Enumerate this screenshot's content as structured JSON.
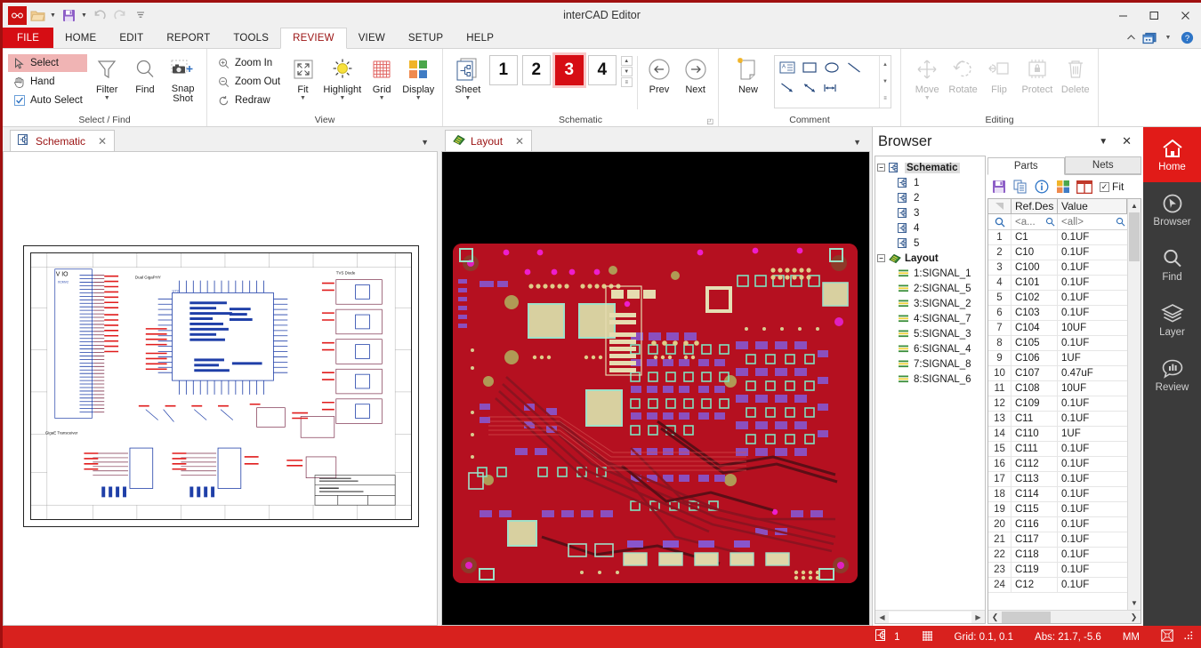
{
  "window": {
    "title": "interCAD Editor",
    "minimize": "–",
    "maximize": "☐",
    "close": "✕"
  },
  "quick_access": {
    "logo": "app-logo",
    "items": [
      {
        "name": "open-icon",
        "label": "Open",
        "has_arrow": true
      },
      {
        "name": "save-icon",
        "label": "Save",
        "has_arrow": true
      },
      {
        "name": "undo-icon",
        "label": "Undo",
        "has_arrow": false
      },
      {
        "name": "redo-icon",
        "label": "Redo",
        "has_arrow": false
      },
      {
        "name": "customize-icon",
        "label": "Customize Quick Access Toolbar",
        "has_arrow": false
      }
    ]
  },
  "menu": {
    "tabs": [
      {
        "label": "FILE",
        "type": "file"
      },
      {
        "label": "HOME",
        "type": "normal"
      },
      {
        "label": "EDIT",
        "type": "normal"
      },
      {
        "label": "REPORT",
        "type": "normal"
      },
      {
        "label": "TOOLS",
        "type": "normal"
      },
      {
        "label": "REVIEW",
        "type": "active"
      },
      {
        "label": "VIEW",
        "type": "normal"
      },
      {
        "label": "SETUP",
        "type": "normal"
      },
      {
        "label": "HELP",
        "type": "normal"
      }
    ],
    "right_icons": [
      "collapse-ribbon-icon",
      "window-mode-icon",
      "window-mode-caret",
      "help-icon"
    ]
  },
  "ribbon": {
    "groups": [
      {
        "label": "Select / Find",
        "small_commands": [
          {
            "label": "Select",
            "icon": "cursor-icon",
            "selected": true
          },
          {
            "label": "Hand",
            "icon": "hand-icon",
            "selected": false
          },
          {
            "label": "Auto Select",
            "icon": "checkbox-checked-icon",
            "selected": false
          }
        ],
        "big_commands": [
          {
            "label": "Filter",
            "icon": "funnel-icon",
            "caret": true,
            "disabled": false
          },
          {
            "label": "Find",
            "icon": "magnifier-icon",
            "caret": false,
            "disabled": false
          },
          {
            "label": "Snap Shot",
            "icon": "camera-plus-icon",
            "caret": false,
            "disabled": false
          }
        ]
      },
      {
        "label": "View",
        "small_commands": [
          {
            "label": "Zoom In",
            "icon": "zoom-in-icon",
            "selected": false
          },
          {
            "label": "Zoom Out",
            "icon": "zoom-out-icon",
            "selected": false
          },
          {
            "label": "Redraw",
            "icon": "refresh-icon",
            "selected": false
          }
        ],
        "big_commands": [
          {
            "label": "Fit",
            "icon": "fit-icon",
            "caret": true,
            "disabled": false
          },
          {
            "label": "Highlight",
            "icon": "sun-icon",
            "caret": true,
            "disabled": false
          },
          {
            "label": "Grid",
            "icon": "grid-icon",
            "caret": true,
            "disabled": false
          },
          {
            "label": "Display",
            "icon": "display-squares-icon",
            "caret": true,
            "disabled": false
          }
        ]
      },
      {
        "label": "Schematic",
        "has_dialog_launcher": true,
        "sheet_button": {
          "label": "Sheet",
          "icon": "sheet-icon",
          "caret": true
        },
        "sheets": [
          "1",
          "2",
          "3",
          "4"
        ],
        "active_sheet": "3",
        "nav": [
          {
            "label": "Prev",
            "icon": "arrow-left-circle-icon"
          },
          {
            "label": "Next",
            "icon": "arrow-right-circle-icon"
          }
        ]
      },
      {
        "label": "Comment",
        "new_button": {
          "label": "New",
          "icon": "new-note-icon"
        },
        "tools": [
          "text-box-icon",
          "rectangle-icon",
          "ellipse-icon",
          "line-icon",
          "arrow-icon",
          "double-arrow-icon",
          "dimension-icon"
        ]
      },
      {
        "label": "Editing",
        "big_commands": [
          {
            "label": "Move",
            "icon": "move-icon",
            "caret": true,
            "disabled": true
          },
          {
            "label": "Rotate",
            "icon": "rotate-icon",
            "caret": false,
            "disabled": true
          },
          {
            "label": "Flip",
            "icon": "flip-icon",
            "caret": false,
            "disabled": true
          },
          {
            "label": "Protect",
            "icon": "protect-chip-icon",
            "caret": false,
            "disabled": true
          },
          {
            "label": "Delete",
            "icon": "trash-icon",
            "caret": false,
            "disabled": true
          }
        ]
      }
    ]
  },
  "panes": [
    {
      "tab_label": "Schematic",
      "tab_icon": "schematic-icon",
      "close": "✕",
      "caret": "▼"
    },
    {
      "tab_label": "Layout",
      "tab_icon": "layout-board-icon",
      "close": "✕",
      "caret": "▼"
    }
  ],
  "browser": {
    "title": "Browser",
    "menu_icon": "▼",
    "close_icon": "✕",
    "tree": [
      {
        "label": "Schematic",
        "level": 0,
        "icon": "schematic-icon",
        "expanded": true,
        "selected": true
      },
      {
        "label": "1",
        "level": 1,
        "icon": "schematic-sheet-icon"
      },
      {
        "label": "2",
        "level": 1,
        "icon": "schematic-sheet-icon"
      },
      {
        "label": "3",
        "level": 1,
        "icon": "schematic-sheet-icon"
      },
      {
        "label": "4",
        "level": 1,
        "icon": "schematic-sheet-icon"
      },
      {
        "label": "5",
        "level": 1,
        "icon": "schematic-sheet-icon"
      },
      {
        "label": "Layout",
        "level": 0,
        "icon": "layout-board-icon",
        "expanded": true,
        "selected": false
      },
      {
        "label": "1:SIGNAL_1",
        "level": 1,
        "icon": "layer-stack-icon"
      },
      {
        "label": "2:SIGNAL_5",
        "level": 1,
        "icon": "layer-stack-icon"
      },
      {
        "label": "3:SIGNAL_2",
        "level": 1,
        "icon": "layer-stack-icon"
      },
      {
        "label": "4:SIGNAL_7",
        "level": 1,
        "icon": "layer-stack-icon"
      },
      {
        "label": "5:SIGNAL_3",
        "level": 1,
        "icon": "layer-stack-icon"
      },
      {
        "label": "6:SIGNAL_4",
        "level": 1,
        "icon": "layer-stack-icon"
      },
      {
        "label": "7:SIGNAL_8",
        "level": 1,
        "icon": "layer-stack-icon"
      },
      {
        "label": "8:SIGNAL_6",
        "level": 1,
        "icon": "layer-stack-icon"
      }
    ],
    "tabs": [
      {
        "label": "Parts",
        "active": true
      },
      {
        "label": "Nets",
        "active": false
      }
    ],
    "toolbar": {
      "icons": [
        "save-icon",
        "copy-icon",
        "info-icon",
        "colors-icon",
        "columns-icon"
      ],
      "fit_label": "Fit",
      "fit_checked": true,
      "fit_check_glyph": "✓"
    },
    "table": {
      "headers": [
        "",
        "Ref.Des",
        "Value"
      ],
      "filters": [
        "",
        "<a...",
        "<all>"
      ],
      "rows": [
        {
          "n": "1",
          "ref": "C1",
          "value": "0.1UF"
        },
        {
          "n": "2",
          "ref": "C10",
          "value": "0.1UF"
        },
        {
          "n": "3",
          "ref": "C100",
          "value": "0.1UF"
        },
        {
          "n": "4",
          "ref": "C101",
          "value": "0.1UF"
        },
        {
          "n": "5",
          "ref": "C102",
          "value": "0.1UF"
        },
        {
          "n": "6",
          "ref": "C103",
          "value": "0.1UF"
        },
        {
          "n": "7",
          "ref": "C104",
          "value": "10UF"
        },
        {
          "n": "8",
          "ref": "C105",
          "value": "0.1UF"
        },
        {
          "n": "9",
          "ref": "C106",
          "value": "1UF"
        },
        {
          "n": "10",
          "ref": "C107",
          "value": "0.47uF"
        },
        {
          "n": "11",
          "ref": "C108",
          "value": "10UF"
        },
        {
          "n": "12",
          "ref": "C109",
          "value": "0.1UF"
        },
        {
          "n": "13",
          "ref": "C11",
          "value": "0.1UF"
        },
        {
          "n": "14",
          "ref": "C110",
          "value": "1UF"
        },
        {
          "n": "15",
          "ref": "C111",
          "value": "0.1UF"
        },
        {
          "n": "16",
          "ref": "C112",
          "value": "0.1UF"
        },
        {
          "n": "17",
          "ref": "C113",
          "value": "0.1UF"
        },
        {
          "n": "18",
          "ref": "C114",
          "value": "0.1UF"
        },
        {
          "n": "19",
          "ref": "C115",
          "value": "0.1UF"
        },
        {
          "n": "20",
          "ref": "C116",
          "value": "0.1UF"
        },
        {
          "n": "21",
          "ref": "C117",
          "value": "0.1UF"
        },
        {
          "n": "22",
          "ref": "C118",
          "value": "0.1UF"
        },
        {
          "n": "23",
          "ref": "C119",
          "value": "0.1UF"
        },
        {
          "n": "24",
          "ref": "C12",
          "value": "0.1UF"
        }
      ]
    }
  },
  "rightnav": {
    "items": [
      {
        "label": "Home",
        "icon": "home-icon",
        "active": true
      },
      {
        "label": "Browser",
        "icon": "browser-cursor-icon",
        "active": false
      },
      {
        "label": "Find",
        "icon": "magnifier-icon",
        "active": false
      },
      {
        "label": "Layer",
        "icon": "layer-stack-icon",
        "active": false
      },
      {
        "label": "Review",
        "icon": "review-comment-icon",
        "active": false
      }
    ]
  },
  "statusbar": {
    "sheet_icon": "schematic-sheet-icon",
    "sheet_number": "1",
    "grid_icon": "grid-icon",
    "grid_text": "Grid: 0.1, 0.1",
    "abs_text": "Abs: 21.7, -5.6",
    "units": "MM",
    "right_icons": [
      "fit-screen-icon",
      "resize-grip-icon"
    ]
  },
  "colors": {
    "brand_red": "#d60d14",
    "status_red": "#d8211e",
    "nav_dark": "#3b3b3b",
    "nav_active": "#e11b18",
    "board_red": "#b51020",
    "accent_purple": "#7b52ab"
  }
}
